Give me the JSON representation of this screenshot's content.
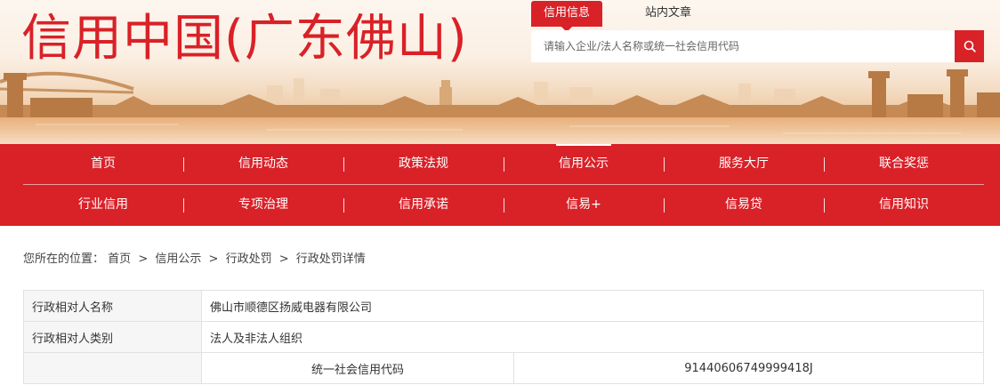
{
  "header": {
    "site_title": "信用中国(广东佛山)",
    "search_tabs": [
      {
        "label": "信用信息",
        "active": true
      },
      {
        "label": "站内文章",
        "active": false
      }
    ],
    "search_placeholder": "请输入企业/法人名称或统一社会信用代码",
    "search_icon": "search-icon",
    "brand_color": "#d92128"
  },
  "nav": {
    "row1": [
      {
        "label": "首页"
      },
      {
        "label": "信用动态"
      },
      {
        "label": "政策法规"
      },
      {
        "label": "信用公示",
        "current": true
      },
      {
        "label": "服务大厅"
      },
      {
        "label": "联合奖惩"
      }
    ],
    "row2": [
      {
        "label": "行业信用"
      },
      {
        "label": "专项治理"
      },
      {
        "label": "信用承诺"
      },
      {
        "label": "信易+"
      },
      {
        "label": "信易贷"
      },
      {
        "label": "信用知识"
      }
    ]
  },
  "breadcrumb": {
    "prefix": "您所在的位置：",
    "items": [
      "首页",
      "信用公示",
      "行政处罚",
      "行政处罚详情"
    ],
    "separator": ">"
  },
  "details": {
    "rows": [
      {
        "label": "行政相对人名称",
        "value": "佛山市顺德区扬威电器有限公司"
      },
      {
        "label": "行政相对人类别",
        "value": "法人及非法人组织"
      }
    ],
    "code_row": {
      "sub_label": "统一社会信用代码",
      "sub_value": "91440606749999418J"
    }
  }
}
